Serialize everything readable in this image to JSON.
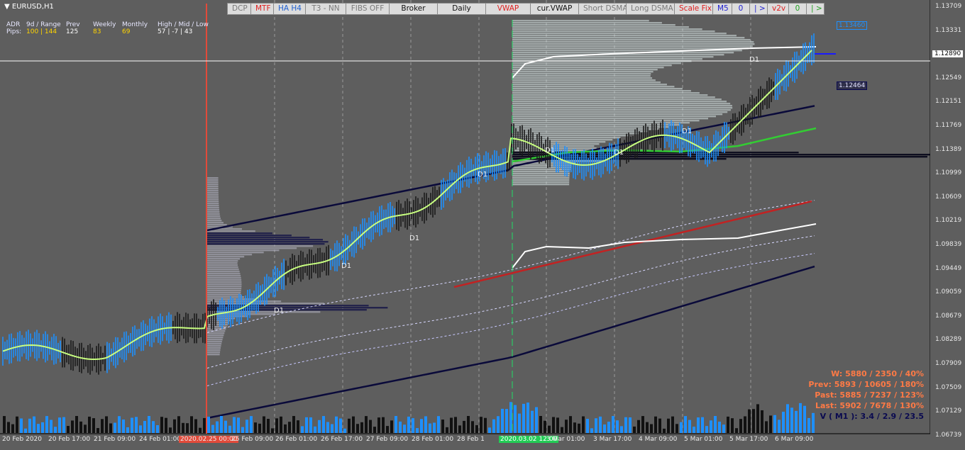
{
  "symbol": "EURUSD,H1",
  "toolbar": [
    {
      "label": "DCP",
      "color": "#7a7a7a"
    },
    {
      "label": "MTF",
      "color": "#e02020"
    },
    {
      "label": "HA H4",
      "color": "#2060d0"
    },
    {
      "label": "T3 - NN",
      "color": "#7a7a7a"
    },
    {
      "label": "FIBS OFF",
      "color": "#7a7a7a"
    },
    {
      "label": "Broker",
      "color": "#111111"
    },
    {
      "label": "Daily",
      "color": "#111111"
    },
    {
      "label": "VWAP",
      "color": "#e02020"
    },
    {
      "label": "cur.VWAP",
      "color": "#111111"
    },
    {
      "label": "Short DSMA",
      "color": "#7a7a7a"
    },
    {
      "label": "Long DSMA",
      "color": "#7a7a7a"
    },
    {
      "label": "Scale Fix",
      "color": "#e02020"
    },
    {
      "label": "M5",
      "color": "#2020d0"
    },
    {
      "label": "0",
      "color": "#2020d0"
    },
    {
      "label": "| >",
      "color": "#2020d0"
    },
    {
      "label": "v2v",
      "color": "#e02020"
    },
    {
      "label": "0",
      "color": "#20a020"
    },
    {
      "label": "| >",
      "color": "#20a020"
    }
  ],
  "adr": {
    "label1": "ADR",
    "label2": "Pips:",
    "range_header": "9d / Range",
    "range_value": "100 | 144",
    "prev_header": "Prev",
    "prev_value": "125",
    "weekly_header": "Weekly",
    "weekly_value": "83",
    "monthly_header": "Monthly",
    "monthly_value": "69",
    "hml_header": "High / Mid / Low",
    "hml_value": "57  |  -7  |  43"
  },
  "stats": {
    "w": "W: 5880 / 2350 / 40%",
    "prev": "Prev: 5893 / 10605 / 180%",
    "past": "Past: 5885 / 7237 / 123%",
    "last": "Last: 5902 / 7678 / 130%",
    "v": "V ( M1 ): 3.4 / 2.9 / 23.5"
  },
  "price_axis": [
    "1.13709",
    "1.13331",
    "1.12890",
    "1.12549",
    "1.12151",
    "1.11769",
    "1.11389",
    "1.10999",
    "1.10609",
    "1.10219",
    "1.09839",
    "1.09449",
    "1.09059",
    "1.08679",
    "1.08289",
    "1.07909",
    "1.07509",
    "1.07129",
    "1.06739"
  ],
  "price_tags": {
    "upper": "1.13460",
    "current": "1.12890",
    "lower": "1.12464"
  },
  "time_axis": [
    "20 Feb 2020",
    "20 Feb 17:00",
    "21 Feb 09:00",
    "24 Feb 01:00",
    "2020.02.25 00:00",
    "25 Feb 09:00",
    "26 Feb 01:00",
    "26 Feb 17:00",
    "27 Feb 09:00",
    "28 Feb 01:00",
    "28 Feb 1",
    "2020.03.02 12:00",
    "3 Mar 01:00",
    "3 Mar 17:00",
    "4 Mar 09:00",
    "5 Mar 01:00",
    "5 Mar 17:00",
    "6 Mar 09:00"
  ],
  "d1_labels": [
    "D1",
    "D1",
    "D1",
    "D1",
    "D1",
    "D1",
    "D1",
    "D1"
  ],
  "colors": {
    "bg": "#5e5e5e",
    "bull": "#1e90ff",
    "ha": "#c8ff80",
    "vwap_upper": "#ffffff",
    "vwap": "#cc2222",
    "dsma": "#101050",
    "green": "#33cc33"
  }
}
